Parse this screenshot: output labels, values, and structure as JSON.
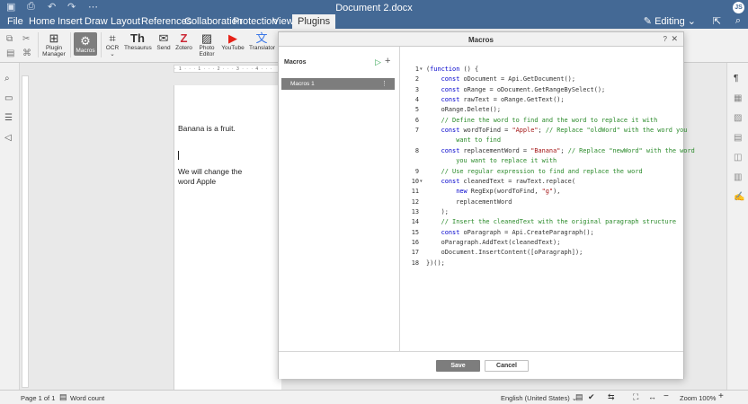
{
  "window": {
    "title": "Document 2.docx",
    "avatar": "JS"
  },
  "tabs": [
    "File",
    "Home",
    "Insert",
    "Draw",
    "Layout",
    "References",
    "Collaboration",
    "Protection",
    "View",
    "Plugins"
  ],
  "active_tab": "Plugins",
  "editing_label": "Editing",
  "ribbon": {
    "plugin_manager": "Plugin Manager",
    "macros": "Macros",
    "ocr": "OCR",
    "thesaurus": "Thesaurus",
    "send": "Send",
    "zotero": "Zotero",
    "photo_editor": "Photo Editor",
    "youtube": "YouTube",
    "translator": "Translator"
  },
  "document": {
    "line1": "Banana is a fruit.",
    "line2a": "We will change the",
    "line2b": "word Apple"
  },
  "dialog": {
    "title": "Macros",
    "help": "?",
    "panel_title": "Macros",
    "macros": [
      "Macros 1"
    ],
    "save": "Save",
    "cancel": "Cancel"
  },
  "code_lines": [
    "(function () {",
    "    const oDocument = Api.GetDocument();",
    "    const oRange = oDocument.GetRangeBySelect();",
    "    const rawText = oRange.GetText();",
    "    oRange.Delete();",
    "    // Define the word to find and the word to replace it with",
    "    const wordToFind = \"Apple\"; // Replace \"oldWord\" with the word you",
    "        want to find",
    "    const replacementWord = \"Banana\"; // Replace \"newWord\" with the word",
    "        you want to replace it with",
    "    // Use regular expression to find and replace the word",
    "    const cleanedText = rawText.replace(",
    "        new RegExp(wordToFind, \"g\"),",
    "        replacementWord",
    "    );",
    "    // Insert the cleanedText with the original paragraph structure",
    "    const oParagraph = Api.CreateParagraph();",
    "    oParagraph.AddText(cleanedText);",
    "    oDocument.InsertContent([oParagraph]);",
    "})();"
  ],
  "line_numbers": [
    "1",
    "2",
    "3",
    "4",
    "5",
    "6",
    "7",
    "",
    "8",
    "",
    "9",
    "10",
    "11",
    "12",
    "13",
    "14",
    "15",
    "16",
    "17",
    "18"
  ],
  "status": {
    "page": "Page 1 of 1",
    "word_count": "Word count",
    "language": "English (United States)",
    "zoom": "Zoom 100%"
  }
}
